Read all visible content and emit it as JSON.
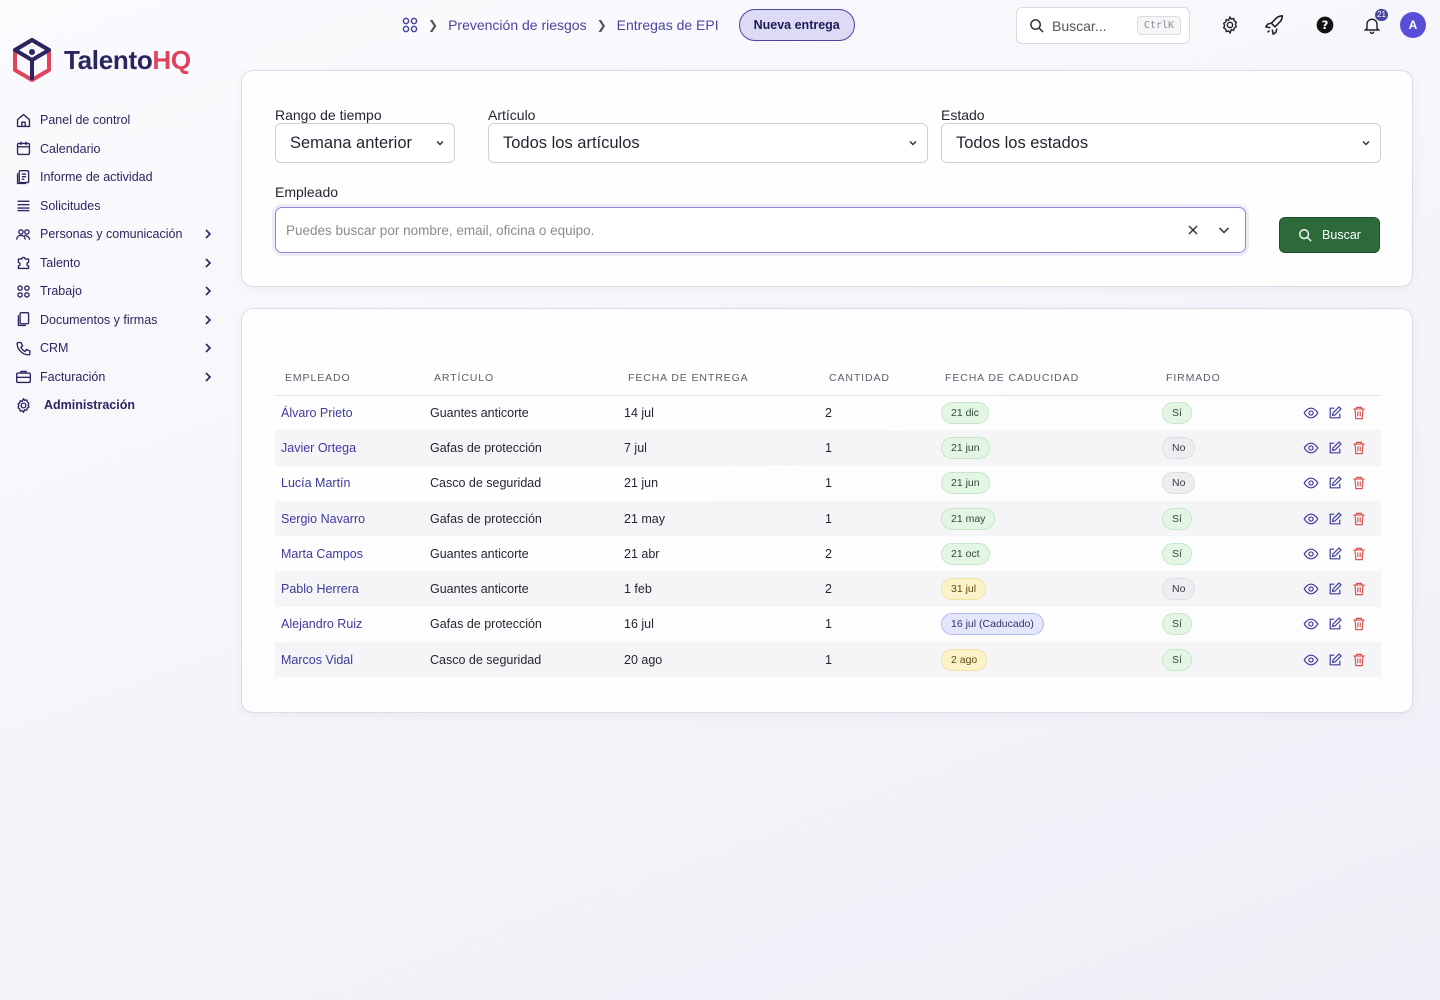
{
  "brand": {
    "name_part1": "Talento",
    "name_part2": "HQ"
  },
  "sidebar": {
    "items": [
      {
        "label": "Panel de control",
        "icon": "home-icon",
        "chevron": false
      },
      {
        "label": "Calendario",
        "icon": "calendar-icon",
        "chevron": false
      },
      {
        "label": "Informe de actividad",
        "icon": "report-icon",
        "chevron": false
      },
      {
        "label": "Solicitudes",
        "icon": "list-icon",
        "chevron": false
      },
      {
        "label": "Personas y comunicación",
        "icon": "people-icon",
        "chevron": true
      },
      {
        "label": "Talento",
        "icon": "puzzle-icon",
        "chevron": true
      },
      {
        "label": "Trabajo",
        "icon": "grid-icon",
        "chevron": true
      },
      {
        "label": "Documentos y firmas",
        "icon": "documents-icon",
        "chevron": true
      },
      {
        "label": "CRM",
        "icon": "phone-icon",
        "chevron": true
      },
      {
        "label": "Facturación",
        "icon": "briefcase-icon",
        "chevron": true
      },
      {
        "label": "Administración",
        "icon": "gear-icon",
        "chevron": false
      }
    ]
  },
  "header": {
    "breadcrumb": [
      "Prevención de riesgos",
      "Entregas de EPI"
    ],
    "new_button": "Nueva entrega",
    "search_placeholder": "Buscar...",
    "search_shortcut": "CtrlK",
    "notifications_count": "21",
    "avatar_initial": "A"
  },
  "filters": {
    "time_range": {
      "label": "Rango de tiempo",
      "value": "Semana anterior"
    },
    "article": {
      "label": "Artículo",
      "value": "Todos los artículos"
    },
    "status": {
      "label": "Estado",
      "value": "Todos los estados"
    },
    "employee": {
      "label": "Empleado",
      "placeholder": "Puedes buscar por nombre, email, oficina o equipo."
    },
    "search_button": "Buscar"
  },
  "table": {
    "columns": [
      "EMPLEADO",
      "ARTÍCULO",
      "FECHA DE ENTREGA",
      "CANTIDAD",
      "FECHA DE CADUCIDAD",
      "FIRMADO"
    ],
    "rows": [
      {
        "employee": "Álvaro Prieto",
        "article": "Guantes anticorte",
        "delivery": "14 jul",
        "qty": "2",
        "expiry": "21 dic",
        "expiry_color": "green",
        "signed": "Sí",
        "signed_color": "green"
      },
      {
        "employee": "Javier Ortega",
        "article": "Gafas de protección",
        "delivery": "7 jul",
        "qty": "1",
        "expiry": "21 jun",
        "expiry_color": "green",
        "signed": "No",
        "signed_color": "gray"
      },
      {
        "employee": "Lucía Martín",
        "article": "Casco de seguridad",
        "delivery": "21 jun",
        "qty": "1",
        "expiry": "21 jun",
        "expiry_color": "green",
        "signed": "No",
        "signed_color": "gray"
      },
      {
        "employee": "Sergio Navarro",
        "article": "Gafas de protección",
        "delivery": "21 may",
        "qty": "1",
        "expiry": "21 may",
        "expiry_color": "green",
        "signed": "Sí",
        "signed_color": "green"
      },
      {
        "employee": "Marta Campos",
        "article": "Guantes anticorte",
        "delivery": "21 abr",
        "qty": "2",
        "expiry": "21 oct",
        "expiry_color": "green",
        "signed": "Sí",
        "signed_color": "green"
      },
      {
        "employee": "Pablo Herrera",
        "article": "Guantes anticorte",
        "delivery": "1 feb",
        "qty": "2",
        "expiry": "31 jul",
        "expiry_color": "yellow",
        "signed": "No",
        "signed_color": "gray"
      },
      {
        "employee": "Alejandro Ruiz",
        "article": "Gafas de protección",
        "delivery": "16 jul",
        "qty": "1",
        "expiry": "16 jul (Caducado)",
        "expiry_color": "blue",
        "signed": "Sí",
        "signed_color": "green"
      },
      {
        "employee": "Marcos Vidal",
        "article": "Casco de seguridad",
        "delivery": "20 ago",
        "qty": "1",
        "expiry": "2 ago",
        "expiry_color": "yellow",
        "signed": "Sí",
        "signed_color": "green"
      }
    ]
  },
  "colors": {
    "accent": "#4a45a0",
    "brand_red": "#e0435e",
    "primary_button": "#2d6a3a",
    "danger": "#d9534f"
  }
}
